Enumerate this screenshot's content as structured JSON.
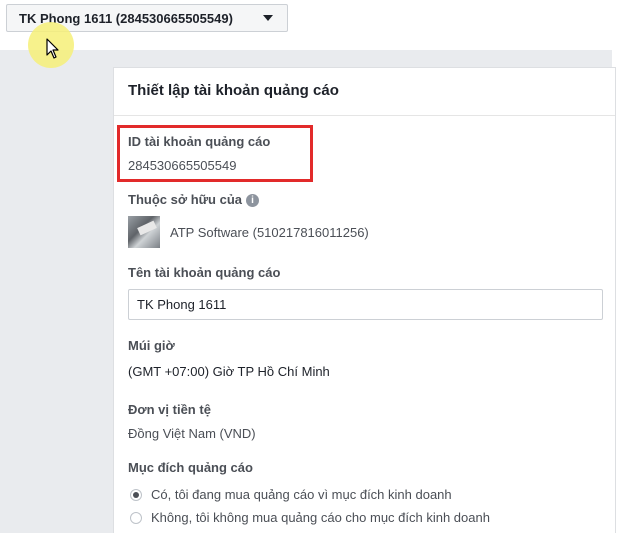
{
  "account_selector": {
    "label": "TK Phong 1611 (284530665505549)"
  },
  "panel": {
    "title": "Thiết lập tài khoản quảng cáo",
    "ad_account_id": {
      "label": "ID tài khoản quảng cáo",
      "value": "284530665505549"
    },
    "owner": {
      "label": "Thuộc sở hữu của",
      "info_icon": "i",
      "name": "ATP Software (510217816011256)"
    },
    "account_name": {
      "label": "Tên tài khoản quảng cáo",
      "value": "TK Phong 1611"
    },
    "timezone": {
      "label": "Múi giờ",
      "value": "(GMT +07:00) Giờ TP Hồ Chí Minh"
    },
    "currency": {
      "label": "Đơn vị tiền tệ",
      "value": "Đồng Việt Nam (VND)"
    },
    "purpose": {
      "label": "Mục đích quảng cáo",
      "options": [
        {
          "label": "Có, tôi đang mua quảng cáo vì mục đích kinh doanh",
          "selected": true
        },
        {
          "label": "Không, tôi không mua quảng cáo cho mục đích kinh doanh",
          "selected": false
        }
      ]
    }
  },
  "colors": {
    "highlight_box": "#e22a2a",
    "page_bg": "#e9ebee",
    "cursor_highlight": "#f6f078"
  }
}
